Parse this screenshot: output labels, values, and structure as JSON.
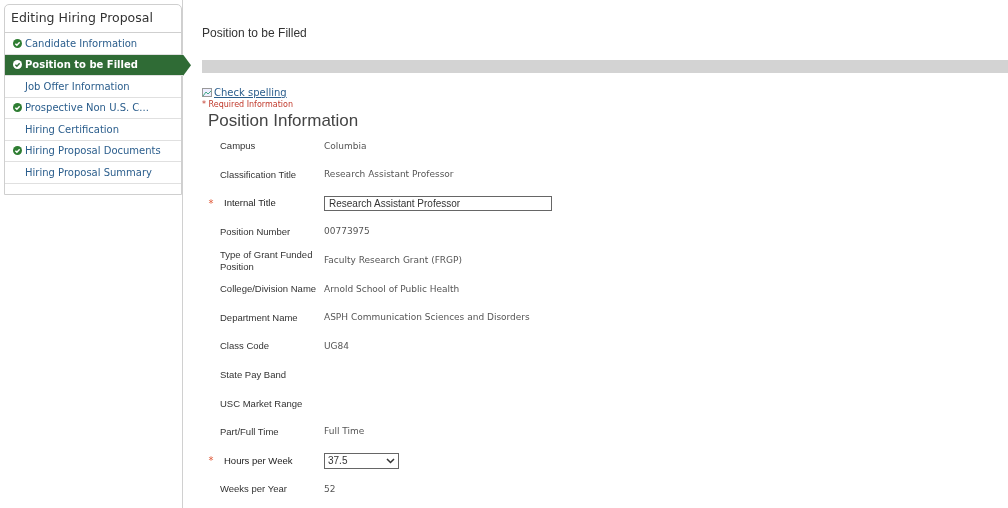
{
  "sidebar": {
    "title": "Editing Hiring Proposal",
    "items": [
      {
        "label": "Candidate Information",
        "completed": true,
        "selected": false
      },
      {
        "label": "Position to be Filled",
        "completed": true,
        "selected": true
      },
      {
        "label": "Job Offer Information",
        "completed": false,
        "selected": false
      },
      {
        "label": "Prospective Non U.S. C...",
        "completed": true,
        "selected": false
      },
      {
        "label": "Hiring Certification",
        "completed": false,
        "selected": false
      },
      {
        "label": "Hiring Proposal Documents",
        "completed": true,
        "selected": false
      },
      {
        "label": "Hiring Proposal Summary",
        "completed": false,
        "selected": false
      }
    ]
  },
  "page_title": "Position to be Filled",
  "spell_check_link": "Check spelling",
  "required_note": "* Required Information",
  "section_title": "Position Information",
  "required_mark": "*",
  "fields": [
    {
      "label": "Campus",
      "kind": "text",
      "required": false,
      "value": "Columbia"
    },
    {
      "label": "Classification Title",
      "kind": "text",
      "required": false,
      "value": "Research Assistant Professor"
    },
    {
      "label": "Internal Title",
      "kind": "input",
      "required": true,
      "value": "Research Assistant Professor"
    },
    {
      "label": "Position Number",
      "kind": "text",
      "required": false,
      "value": "00773975"
    },
    {
      "label": "Type of Grant Funded Position",
      "kind": "text",
      "required": false,
      "value": "Faculty Research Grant (FRGP)"
    },
    {
      "label": "College/Division Name",
      "kind": "text",
      "required": false,
      "value": "Arnold School of Public Health"
    },
    {
      "label": "Department Name",
      "kind": "text",
      "required": false,
      "value": "ASPH Communication Sciences and Disorders"
    },
    {
      "label": "Class Code",
      "kind": "text",
      "required": false,
      "value": "UG84"
    },
    {
      "label": "State Pay Band",
      "kind": "text",
      "required": false
    },
    {
      "label": "USC Market Range",
      "kind": "text",
      "required": false
    },
    {
      "label": "Part/Full Time",
      "kind": "text",
      "required": false,
      "value": "Full Time"
    },
    {
      "label": "Hours per Week",
      "kind": "select",
      "required": true,
      "value": "37.5"
    },
    {
      "label": "Weeks per Year",
      "kind": "text",
      "required": false,
      "value": "52"
    }
  ]
}
